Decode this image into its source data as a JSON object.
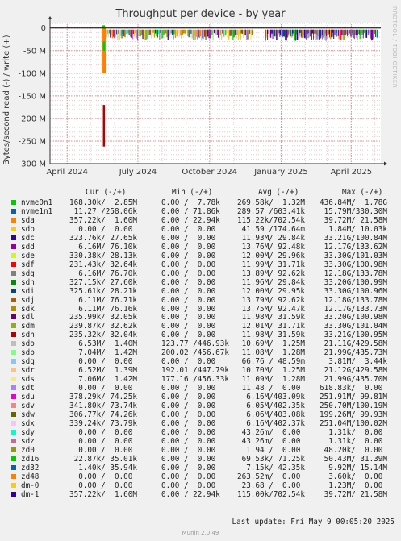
{
  "title": "Throughput per device - by year",
  "ylabel": "Bytes/second read (-) / write (+)",
  "side_label": "RRDTOOL / TOBI OETIKER",
  "legend_headers": [
    "Cur (-/+)",
    "Min (-/+)",
    "Avg (-/+)",
    "Max (-/+)"
  ],
  "rows": [
    {
      "name": "nvme0n1",
      "color": "#00cc00",
      "cur": "168.30k/  2.85M",
      "min": "0.00 /  7.78k",
      "avg": "269.58k/  1.32M",
      "max": "436.84M/  1.78G"
    },
    {
      "name": "nvme1n1",
      "color": "#0066b3",
      "cur": " 11.27 /258.06k",
      "min": "0.00 / 71.86k",
      "avg": "289.57 /603.41k",
      "max": " 15.79M/330.30M"
    },
    {
      "name": "sda",
      "color": "#ff8000",
      "cur": "357.22k/  1.60M",
      "min": "0.00 / 22.94k",
      "avg": "115.22k/702.54k",
      "max": " 39.72M/ 21.58M"
    },
    {
      "name": "sdb",
      "color": "#ffcc00",
      "cur": "  0.00 /  0.00",
      "min": "0.00 /  0.00",
      "avg": " 41.59 /174.64m",
      "max": "  1.84M/ 10.03k"
    },
    {
      "name": "sdc",
      "color": "#330099",
      "cur": "323.76k/ 27.65k",
      "min": "0.00 /  0.00",
      "avg": " 11.93M/ 29.84k",
      "max": " 33.21G/100.84M"
    },
    {
      "name": "sdd",
      "color": "#990099",
      "cur": "  6.16M/ 76.10k",
      "min": "0.00 /  0.00",
      "avg": " 13.76M/ 92.48k",
      "max": " 12.17G/133.62M"
    },
    {
      "name": "sde",
      "color": "#ccff00",
      "cur": "330.38k/ 28.13k",
      "min": "0.00 /  0.00",
      "avg": " 12.00M/ 29.96k",
      "max": " 33.30G/101.03M"
    },
    {
      "name": "sdf",
      "color": "#ff0000",
      "cur": "231.43k/ 32.64k",
      "min": "0.00 /  0.00",
      "avg": " 11.99M/ 31.71k",
      "max": " 33.30G/100.98M"
    },
    {
      "name": "sdg",
      "color": "#808080",
      "cur": "  6.16M/ 76.70k",
      "min": "0.00 /  0.00",
      "avg": " 13.89M/ 92.62k",
      "max": " 12.18G/133.78M"
    },
    {
      "name": "sdh",
      "color": "#008f00",
      "cur": "327.15k/ 27.60k",
      "min": "0.00 /  0.00",
      "avg": " 11.96M/ 29.84k",
      "max": " 33.20G/100.99M"
    },
    {
      "name": "sdi",
      "color": "#00487d",
      "cur": "325.61k/ 28.21k",
      "min": "0.00 /  0.00",
      "avg": " 12.00M/ 29.95k",
      "max": " 33.30G/100.96M"
    },
    {
      "name": "sdj",
      "color": "#b35a00",
      "cur": "  6.11M/ 76.71k",
      "min": "0.00 /  0.00",
      "avg": " 13.79M/ 92.62k",
      "max": " 12.18G/133.78M"
    },
    {
      "name": "sdk",
      "color": "#b38f00",
      "cur": "  6.11M/ 76.16k",
      "min": "0.00 /  0.00",
      "avg": " 13.75M/ 92.47k",
      "max": " 12.17G/133.73M"
    },
    {
      "name": "sdl",
      "color": "#6b006b",
      "cur": "235.99k/ 32.05k",
      "min": "0.00 /  0.00",
      "avg": " 11.98M/ 31.59k",
      "max": " 33.20G/100.98M"
    },
    {
      "name": "sdm",
      "color": "#8fb300",
      "cur": "239.87k/ 32.62k",
      "min": "0.00 /  0.00",
      "avg": " 12.01M/ 31.71k",
      "max": " 33.30G/101.04M"
    },
    {
      "name": "sdn",
      "color": "#b30000",
      "cur": "235.32k/ 32.04k",
      "min": "0.00 /  0.00",
      "avg": " 11.98M/ 31.59k",
      "max": " 33.21G/100.95M"
    },
    {
      "name": "sdo",
      "color": "#bebebe",
      "cur": "  6.53M/  1.40M",
      "min": "123.77 /446.93k",
      "avg": " 10.69M/  1.25M",
      "max": " 21.11G/429.58M"
    },
    {
      "name": "sdp",
      "color": "#80ff80",
      "cur": "  7.04M/  1.42M",
      "min": "200.02 /456.67k",
      "avg": " 11.08M/  1.28M",
      "max": " 21.99G/435.73M"
    },
    {
      "name": "sdq",
      "color": "#80c9ff",
      "cur": "  0.00 /  0.00",
      "min": "0.00 /  0.00",
      "avg": " 66.76 / 48.59m",
      "max": "  3.81M/  3.44k"
    },
    {
      "name": "sdr",
      "color": "#ffc080",
      "cur": "  6.52M/  1.39M",
      "min": "192.01 /447.79k",
      "avg": " 10.70M/  1.25M",
      "max": " 21.12G/429.58M"
    },
    {
      "name": "sds",
      "color": "#ffe680",
      "cur": "  7.06M/  1.42M",
      "min": "177.16 /456.33k",
      "avg": " 11.09M/  1.28M",
      "max": " 21.99G/435.70M"
    },
    {
      "name": "sdt",
      "color": "#aa80ff",
      "cur": "  0.00 /  0.00",
      "min": "0.00 /  0.00",
      "avg": " 11.48 /  0.00",
      "max": "618.83k/  0.00"
    },
    {
      "name": "sdu",
      "color": "#ee00cc",
      "cur": "378.29k/ 74.25k",
      "min": "0.00 /  0.00",
      "avg": "  6.16M/403.09k",
      "max": "251.91M/ 99.81M"
    },
    {
      "name": "sdv",
      "color": "#ff8080",
      "cur": "341.80k/ 73.74k",
      "min": "0.00 /  0.00",
      "avg": "  6.05M/402.35k",
      "max": "250.70M/100.19M"
    },
    {
      "name": "sdw",
      "color": "#666600",
      "cur": "306.77k/ 74.26k",
      "min": "0.00 /  0.00",
      "avg": "  6.06M/403.08k",
      "max": "199.26M/ 99.93M"
    },
    {
      "name": "sdx",
      "color": "#ffbfff",
      "cur": "339.24k/ 73.79k",
      "min": "0.00 /  0.00",
      "avg": "  6.16M/402.37k",
      "max": "251.04M/100.02M"
    },
    {
      "name": "sdy",
      "color": "#00ffcc",
      "cur": "  0.00 /  0.00",
      "min": "0.00 /  0.00",
      "avg": " 43.26m/  0.00",
      "max": "  1.31k/  0.00"
    },
    {
      "name": "sdz",
      "color": "#cc6699",
      "cur": "  0.00 /  0.00",
      "min": "0.00 /  0.00",
      "avg": " 43.26m/  0.00",
      "max": "  1.31k/  0.00"
    },
    {
      "name": "zd0",
      "color": "#999900",
      "cur": "  0.00 /  0.00",
      "min": "0.00 /  0.00",
      "avg": "  1.94 /  0.00",
      "max": " 48.20k/  0.00"
    },
    {
      "name": "zd16",
      "color": "#00cc00",
      "cur": " 22.87k/ 35.01k",
      "min": "0.00 /  0.00",
      "avg": " 69.53k/ 71.25k",
      "max": " 50.43M/ 31.39M"
    },
    {
      "name": "zd32",
      "color": "#0066b3",
      "cur": "  1.40k/ 35.94k",
      "min": "0.00 /  0.00",
      "avg": "  7.15k/ 42.35k",
      "max": "  9.92M/ 15.14M"
    },
    {
      "name": "zd48",
      "color": "#ff8000",
      "cur": "  0.00 /  0.00",
      "min": "0.00 /  0.00",
      "avg": "263.52m/  0.00",
      "max": "  3.60k/  0.00"
    },
    {
      "name": "dm-0",
      "color": "#ffcc00",
      "cur": "  0.00 /  0.00",
      "min": "0.00 /  0.00",
      "avg": " 23.68 /  0.00",
      "max": "  1.23M/  0.00"
    },
    {
      "name": "dm-1",
      "color": "#330099",
      "cur": "357.22k/  1.60M",
      "min": "0.00 / 22.94k",
      "avg": "115.00k/702.54k",
      "max": " 39.72M/ 21.58M"
    }
  ],
  "last_update": "Last update: Fri May  9 00:05:20 2025",
  "footer": "Munin 2.0.49",
  "chart_data": {
    "type": "area",
    "title": "Throughput per device - by year",
    "ylabel": "Bytes/second read (-) / write (+)",
    "y_ticks": [
      "0",
      "-50 M",
      "-100 M",
      "-150 M",
      "-200 M",
      "-250 M",
      "-300 M"
    ],
    "y_tick_values": [
      0,
      -50,
      -100,
      -150,
      -200,
      -250,
      -300
    ],
    "y_unit": "M",
    "ylim": [
      -300,
      12
    ],
    "x_ticks": [
      "April 2024",
      "July 2024",
      "October 2024",
      "January 2025",
      "April 2025"
    ],
    "x_tick_dates": [
      "2024-04-01",
      "2024-07-01",
      "2024-10-01",
      "2025-01-01",
      "2025-04-01"
    ],
    "xlim": [
      "2024-03-10",
      "2025-05-09"
    ],
    "grid": true,
    "spike": {
      "date": "2024-05-18",
      "min_value": -262
    },
    "data_start": "2024-05-18"
  }
}
